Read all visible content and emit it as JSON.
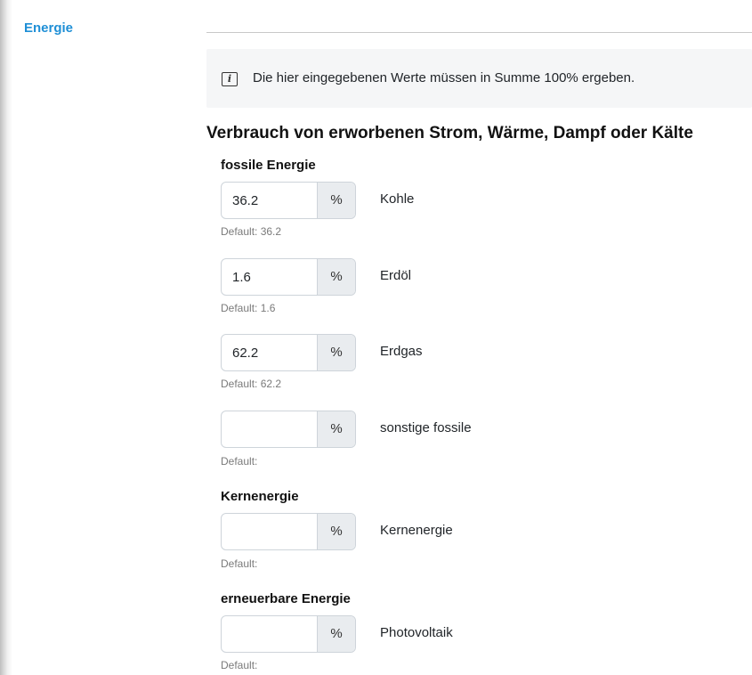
{
  "sidebar": {
    "active_item": "Energie"
  },
  "info": {
    "icon": "info-icon",
    "text": "Die hier eingegebenen Werte müssen in Summe 100% ergeben."
  },
  "section": {
    "title": "Verbrauch von erworbenen Strom, Wärme, Dampf oder Kälte"
  },
  "groups": [
    {
      "title": "fossile Energie",
      "fields": [
        {
          "value": "36.2",
          "unit": "%",
          "label": "Kohle",
          "default": "Default: 36.2"
        },
        {
          "value": "1.6",
          "unit": "%",
          "label": "Erdöl",
          "default": "Default: 1.6"
        },
        {
          "value": "62.2",
          "unit": "%",
          "label": "Erdgas",
          "default": "Default: 62.2"
        },
        {
          "value": "",
          "unit": "%",
          "label": "sonstige fossile",
          "default": "Default:"
        }
      ]
    },
    {
      "title": "Kernenergie",
      "fields": [
        {
          "value": "",
          "unit": "%",
          "label": "Kernenergie",
          "default": "Default:"
        }
      ]
    },
    {
      "title": "erneuerbare Energie",
      "fields": [
        {
          "value": "",
          "unit": "%",
          "label": "Photovoltaik",
          "default": "Default:"
        }
      ]
    }
  ]
}
